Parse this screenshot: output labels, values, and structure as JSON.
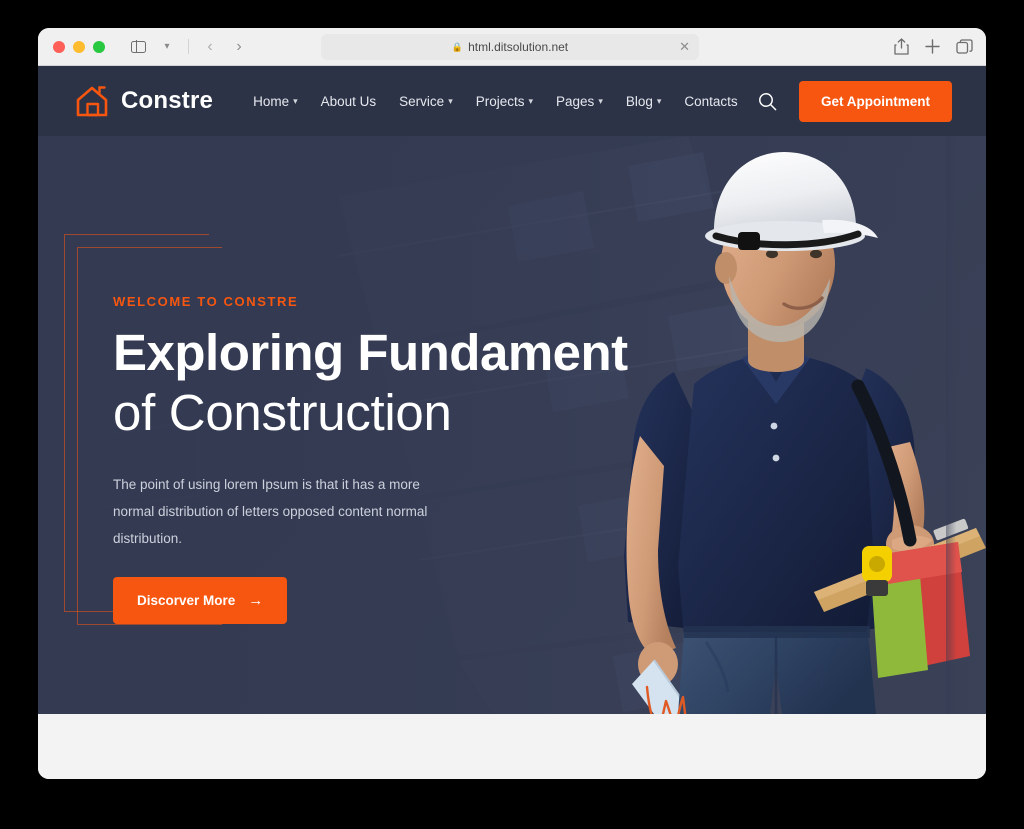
{
  "browser": {
    "url": "html.ditsolution.net",
    "lock_icon": "lock-icon",
    "stop_icon": "close-icon",
    "sidebar_icon": "sidebar-toggle-icon",
    "back_icon": "chevron-left-icon",
    "forward_icon": "chevron-right-icon",
    "share_icon": "share-icon",
    "newtab_icon": "plus-icon",
    "tabs_icon": "tab-overview-icon"
  },
  "header": {
    "brand": "Constre",
    "logo_icon": "house-icon",
    "search_icon": "search-icon",
    "appointment_label": "Get Appointment",
    "nav": [
      {
        "label": "Home",
        "has_dropdown": true
      },
      {
        "label": "About Us",
        "has_dropdown": false
      },
      {
        "label": "Service",
        "has_dropdown": true
      },
      {
        "label": "Projects",
        "has_dropdown": true
      },
      {
        "label": "Pages",
        "has_dropdown": true
      },
      {
        "label": "Blog",
        "has_dropdown": true
      },
      {
        "label": "Contacts",
        "has_dropdown": false
      }
    ]
  },
  "hero": {
    "eyebrow": "WELCOME TO CONSTRE",
    "title_bold": "Exploring Fundament",
    "title_light": "of Construction",
    "paragraph": "The point of using lorem Ipsum is that it has a more normal distribution of letters opposed content normal distribution.",
    "button_label": "Discorver More",
    "button_arrow": "→",
    "image_alt": "construction-worker-with-hard-hat-and-clipboard",
    "scribble_alt": "orange-zigzag-accent"
  },
  "colors": {
    "accent": "#F6560F",
    "header_bg": "#2C3347",
    "hero_bg": "#333A52",
    "below_fold_bg": "#F3F3F3"
  }
}
